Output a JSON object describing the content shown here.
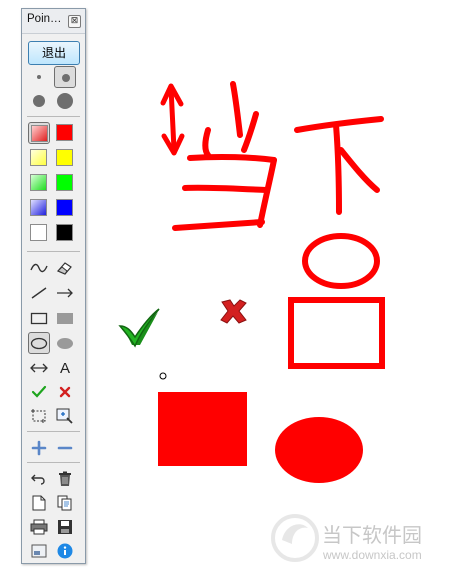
{
  "window": {
    "title": "Poin…",
    "close_glyph": "⊠"
  },
  "exit_button": {
    "label": "退出"
  },
  "pen_sizes": [
    {
      "name": "pen-size-small"
    },
    {
      "name": "pen-size-medium",
      "selected": true
    },
    {
      "name": "pen-size-large"
    },
    {
      "name": "pen-size-xlarge"
    }
  ],
  "colors": [
    {
      "name": "light-red",
      "hex": "#e86a6a",
      "selected": true
    },
    {
      "name": "red",
      "hex": "#ff0000"
    },
    {
      "name": "light-yellow",
      "hex": "#ffff88"
    },
    {
      "name": "yellow",
      "hex": "#ffff00"
    },
    {
      "name": "light-green",
      "hex": "#66ee66"
    },
    {
      "name": "green",
      "hex": "#00ff00"
    },
    {
      "name": "light-blue",
      "hex": "#6666ee"
    },
    {
      "name": "blue",
      "hex": "#0000ff"
    },
    {
      "name": "white",
      "hex": "#ffffff"
    },
    {
      "name": "black",
      "hex": "#000000"
    }
  ],
  "tools": {
    "text_tool_label": "A",
    "selected_tool": "ellipse-outline"
  },
  "canvas_text": {
    "handwriting": "当下"
  },
  "watermark": {
    "brand": "当下软件园",
    "url": "www.downxia.com"
  },
  "accent_colors": {
    "ink": "#ff0000",
    "check": "#1ea51e",
    "cross": "#d32020",
    "info": "#1e88e5"
  }
}
